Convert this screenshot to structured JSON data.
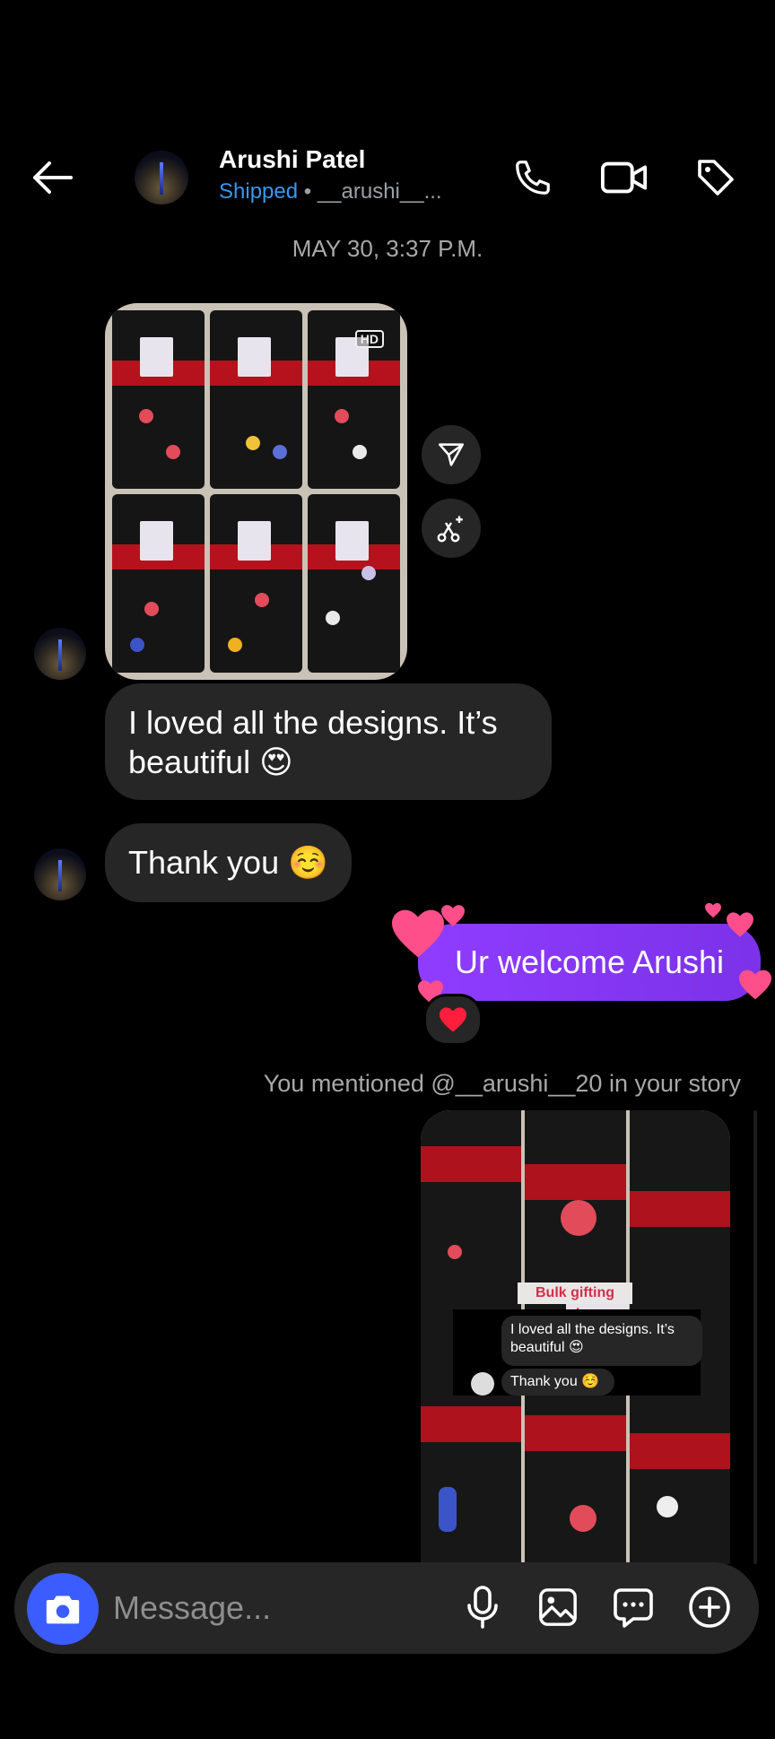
{
  "header": {
    "name": "Arushi Patel",
    "status": "Shipped",
    "separator": "•",
    "username": "__arushi__...",
    "back_icon": "back-arrow-icon",
    "call_icon": "phone-icon",
    "video_icon": "video-camera-icon",
    "tag_icon": "tag-icon"
  },
  "date_divider": "MAY 30, 3:37 P.M.",
  "photo": {
    "hd_badge": "HD"
  },
  "side_actions": [
    "share-icon",
    "ai-edit-icon"
  ],
  "messages": [
    {
      "from": "them",
      "text": "I loved all the designs. It’s beautiful 😍"
    },
    {
      "from": "them",
      "text": "Thank you ☺️"
    },
    {
      "from": "me",
      "text": "Ur welcome Arushi",
      "reaction": "❤️"
    }
  ],
  "story_mention": "You mentioned @__arushi__20 in your story",
  "story": {
    "banner": "Bulk gifting rewiew",
    "bubble1": "I loved all the designs. It’s beautiful 😍",
    "bubble2": "Thank you ☺️"
  },
  "composer": {
    "placeholder": "Message...",
    "icons": [
      "camera-icon",
      "microphone-icon",
      "gallery-icon",
      "sticker-chat-icon",
      "plus-circle-icon"
    ]
  },
  "colors": {
    "accent": "#3b5cff",
    "status": "#3897f0",
    "my_bubble": "#8f3cff",
    "their_bubble": "#262626",
    "heart": "#ff4f8b"
  }
}
